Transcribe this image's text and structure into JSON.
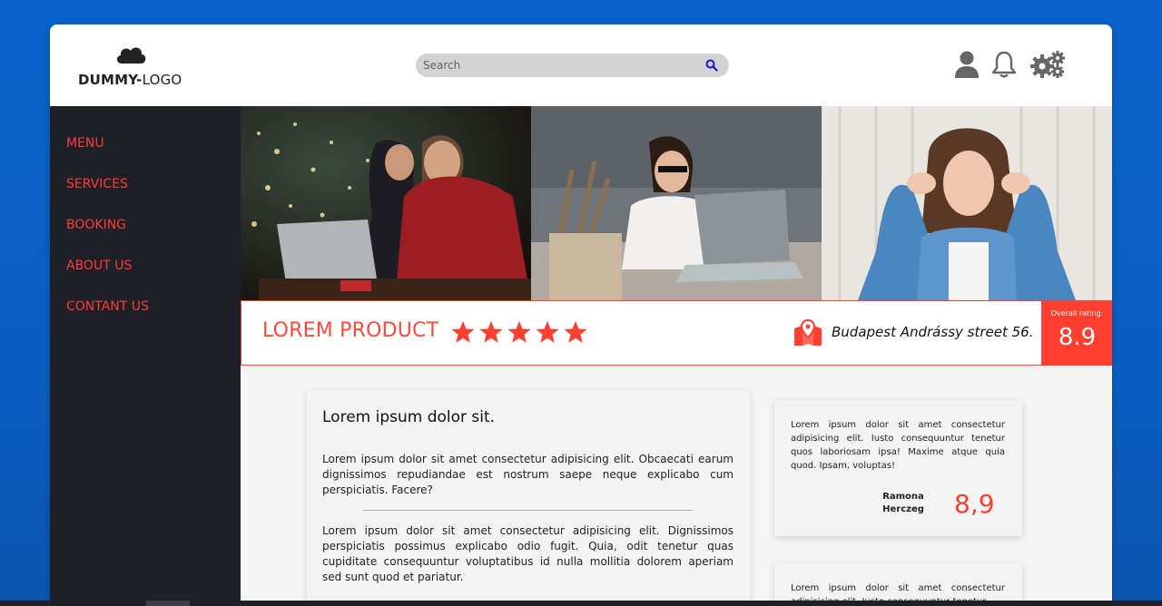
{
  "header": {
    "logo_bold": "DUMMY-",
    "logo_light": "LOGO",
    "search_placeholder": "Search",
    "icons": [
      "user-icon",
      "bell-icon",
      "gears-icon"
    ]
  },
  "sidebar": {
    "items": [
      {
        "label": "MENU"
      },
      {
        "label": "SERVICES"
      },
      {
        "label": "BOOKING"
      },
      {
        "label": "ABOUT US"
      },
      {
        "label": "CONTANT US"
      }
    ]
  },
  "product": {
    "title": "LOREM PRODUCT",
    "stars": 5,
    "address": "Budapest Andrássy street 56.",
    "rating_label": "Overall rating:",
    "rating_value": "8.9"
  },
  "main_card": {
    "heading": "Lorem ipsum dolor sit.",
    "paragraph1": "Lorem ipsum dolor sit amet consectetur adipisicing elit. Obcaecati earum dignissimos repudiandae est nostrum saepe neque explicabo cum perspiciatis. Facere?",
    "paragraph2": "Lorem ipsum dolor sit amet consectetur adipisicing elit. Dignissimos perspiciatis possimus explicabo odio fugit. Quia, odit tenetur quas cupiditate consequuntur voluptatibus id nulla mollitia dolorem aperiam sed sunt quod et pariatur."
  },
  "reviews": [
    {
      "text": "Lorem ipsum dolor sit amet consectetur adipisicing elit. Iusto consequuntur tenetur quos laboriosam ipsa! Maxime atque quia quod. Ipsam, voluptas!",
      "name": "Ramona Herczeg",
      "score": "8,9"
    },
    {
      "text": "Lorem ipsum dolor sit amet consectetur adipisicing elit. Iusto consequuntur tenetur"
    }
  ],
  "colors": {
    "accent": "#ff4030",
    "sidebar": "#1d2026",
    "nav_text": "#ff3a3a"
  }
}
